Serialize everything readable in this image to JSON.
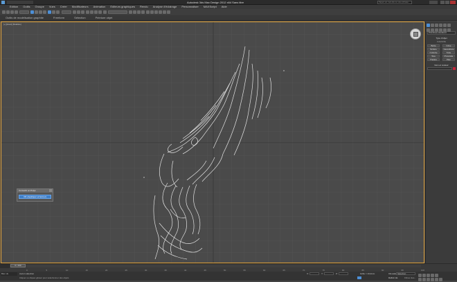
{
  "titlebar": {
    "title": "Autodesk 3ds Max Design 2012 x64    Sans titre",
    "search_placeholder": "Tapez un mot-clé ou une phrase"
  },
  "menu": [
    "Edition",
    "Outils",
    "Groupe",
    "Vues",
    "Créer",
    "Modificateurs",
    "Animation",
    "Editeurs graphiques",
    "Rendu",
    "Analyse d'éclairage",
    "Personnaliser",
    "MAXScript",
    "Aide"
  ],
  "toolbar": {
    "select_filter": "Tout",
    "view_dropdown": "Vue",
    "selection_set": "Créer un jeu de sé..."
  },
  "ribbon_tabs": [
    "Outils de modélisation graphite",
    "Freeform",
    "Sélection",
    "Peinture objet"
  ],
  "viewport": {
    "label": "[+] [Haut] [Réaliste]"
  },
  "dialog": {
    "title": "Convertir en Polys",
    "button": "OK (Appliquer et fermer)"
  },
  "cmdpanel": {
    "dropdown": "Primitives standard",
    "rollout_title": "Type d'objet",
    "autogrid": "AutoGrille",
    "buttons": [
      "Boîte",
      "Cône",
      "Sphère",
      "Géosphère",
      "Cylindre",
      "Tube",
      "Tore",
      "Pyramide",
      "Théière",
      "Plan"
    ],
    "name_title": "Nom et couleur",
    "accent_color": "#c4253a"
  },
  "timeline": {
    "frame": "0 / 100",
    "ticks": [
      "0",
      "5",
      "10",
      "15",
      "20",
      "25",
      "30",
      "35",
      "40",
      "45",
      "50",
      "55",
      "60",
      "65",
      "70",
      "75",
      "80",
      "85",
      "90",
      "95",
      "100"
    ]
  },
  "status": {
    "selection": "Aucun sélection",
    "prompt": "Cliquer ou cliquer-glisser pour sélectionner des objets",
    "welcome": "Bien ds MAXScript",
    "x_label": "X:",
    "y_label": "Y:",
    "z_label": "Z:",
    "grid": "Grille = 10,0mm",
    "autokey": "Clé auto",
    "selection_mode": "Sélection",
    "set_key": "Définir clé",
    "filters": "Filtres clés..."
  }
}
